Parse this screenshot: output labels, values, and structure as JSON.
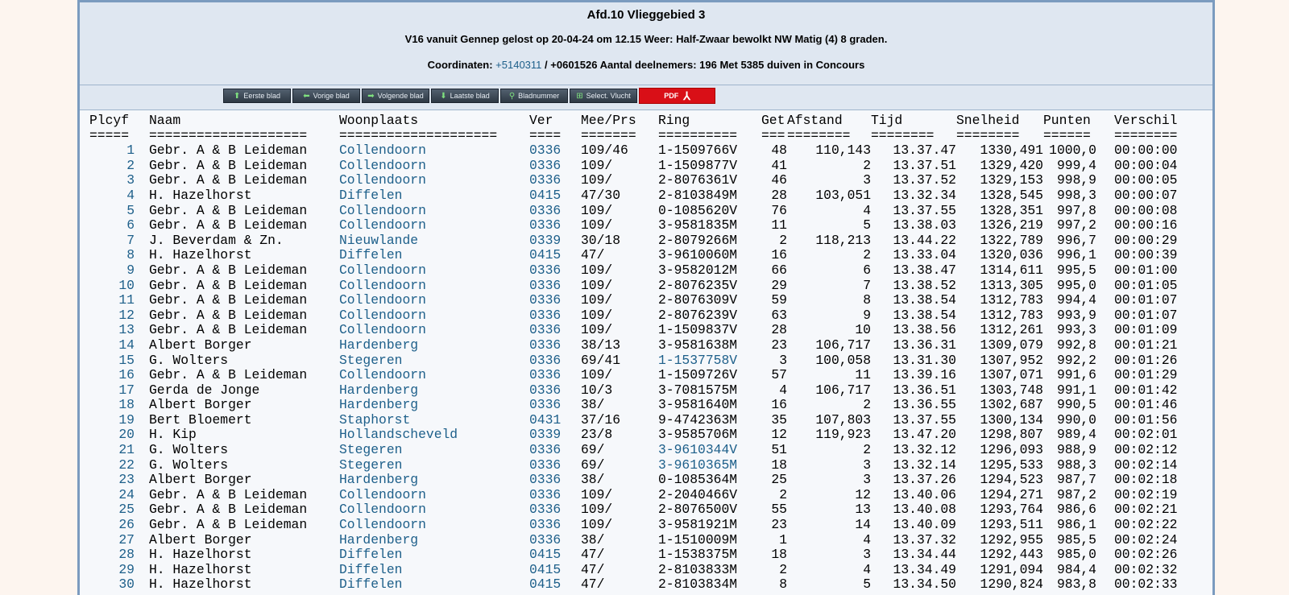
{
  "header": {
    "title": "Afd.10 Vlieggebied 3",
    "flight_info": "V16 vanuit Gennep gelost op 20-04-24 om 12.15 Weer: Half-Zwaar bewolkt NW Matig (4) 8 graden.",
    "coord_label": "Coordinaten:",
    "coord_lat": "+5140311",
    "coord_rest": "/ +0601526 Aantal deelnemers: 196 Met 5385 duiven in Concours"
  },
  "toolbar": {
    "buttons": [
      {
        "label": "Eerste blad",
        "icon": "arrow-up-icon"
      },
      {
        "label": "Vorige blad",
        "icon": "arrow-left-icon"
      },
      {
        "label": "Volgende blad",
        "icon": "arrow-right-icon"
      },
      {
        "label": "Laatste blad",
        "icon": "arrow-down-icon"
      },
      {
        "label": "Bladnummer",
        "icon": "search-icon"
      },
      {
        "label": "Select. Vlucht",
        "icon": "plus-icon"
      }
    ],
    "pdf_label": "PDF"
  },
  "columns": [
    "Plcyf",
    "Naam",
    "Woonplaats",
    "Ver",
    "Mee/Prs",
    "Ring",
    "Get",
    "Afstand",
    "Tijd",
    "Snelheid",
    "Punten",
    "Verschil"
  ],
  "underlines": [
    "=====",
    "====================",
    "====================",
    "====",
    "=======",
    "==========",
    "===",
    "========",
    "========",
    "========",
    "======",
    "========"
  ],
  "rows": [
    [
      "1",
      "Gebr. A & B Leideman",
      "Collendoorn",
      "0336",
      "109/46",
      "1-1509766V",
      "48",
      "110,143",
      "13.37.47",
      "1330,491",
      "1000,0",
      "00:00:00"
    ],
    [
      "2",
      "Gebr. A & B Leideman",
      "Collendoorn",
      "0336",
      "109/",
      "1-1509877V",
      "41",
      "2",
      "13.37.51",
      "1329,420",
      "999,4",
      "00:00:04"
    ],
    [
      "3",
      "Gebr. A & B Leideman",
      "Collendoorn",
      "0336",
      "109/",
      "2-8076361V",
      "46",
      "3",
      "13.37.52",
      "1329,153",
      "998,9",
      "00:00:05"
    ],
    [
      "4",
      "H. Hazelhorst",
      "Diffelen",
      "0415",
      "47/30",
      "2-8103849M",
      "28",
      "103,051",
      "13.32.34",
      "1328,545",
      "998,3",
      "00:00:07"
    ],
    [
      "5",
      "Gebr. A & B Leideman",
      "Collendoorn",
      "0336",
      "109/",
      "0-1085620V",
      "76",
      "4",
      "13.37.55",
      "1328,351",
      "997,8",
      "00:00:08"
    ],
    [
      "6",
      "Gebr. A & B Leideman",
      "Collendoorn",
      "0336",
      "109/",
      "3-9581835M",
      "11",
      "5",
      "13.38.03",
      "1326,219",
      "997,2",
      "00:00:16"
    ],
    [
      "7",
      "J. Beverdam & Zn.",
      "Nieuwlande",
      "0339",
      "30/18",
      "2-8079266M",
      "2",
      "118,213",
      "13.44.22",
      "1322,789",
      "996,7",
      "00:00:29"
    ],
    [
      "8",
      "H. Hazelhorst",
      "Diffelen",
      "0415",
      "47/",
      "3-9610060M",
      "16",
      "2",
      "13.33.04",
      "1320,036",
      "996,1",
      "00:00:39"
    ],
    [
      "9",
      "Gebr. A & B Leideman",
      "Collendoorn",
      "0336",
      "109/",
      "3-9582012M",
      "66",
      "6",
      "13.38.47",
      "1314,611",
      "995,5",
      "00:01:00"
    ],
    [
      "10",
      "Gebr. A & B Leideman",
      "Collendoorn",
      "0336",
      "109/",
      "2-8076235V",
      "29",
      "7",
      "13.38.52",
      "1313,305",
      "995,0",
      "00:01:05"
    ],
    [
      "11",
      "Gebr. A & B Leideman",
      "Collendoorn",
      "0336",
      "109/",
      "2-8076309V",
      "59",
      "8",
      "13.38.54",
      "1312,783",
      "994,4",
      "00:01:07"
    ],
    [
      "12",
      "Gebr. A & B Leideman",
      "Collendoorn",
      "0336",
      "109/",
      "2-8076239V",
      "63",
      "9",
      "13.38.54",
      "1312,783",
      "993,9",
      "00:01:07"
    ],
    [
      "13",
      "Gebr. A & B Leideman",
      "Collendoorn",
      "0336",
      "109/",
      "1-1509837V",
      "28",
      "10",
      "13.38.56",
      "1312,261",
      "993,3",
      "00:01:09"
    ],
    [
      "14",
      "Albert Borger",
      "Hardenberg",
      "0336",
      "38/13",
      "3-9581638M",
      "23",
      "106,717",
      "13.36.31",
      "1309,079",
      "992,8",
      "00:01:21"
    ],
    [
      "15",
      "G. Wolters",
      "Stegeren",
      "0336",
      "69/41",
      "1-1537758V",
      "3",
      "100,058",
      "13.31.30",
      "1307,952",
      "992,2",
      "00:01:26"
    ],
    [
      "16",
      "Gebr. A & B Leideman",
      "Collendoorn",
      "0336",
      "109/",
      "1-1509726V",
      "57",
      "11",
      "13.39.16",
      "1307,071",
      "991,6",
      "00:01:29"
    ],
    [
      "17",
      "Gerda de Jonge",
      "Hardenberg",
      "0336",
      "10/3",
      "3-7081575M",
      "4",
      "106,717",
      "13.36.51",
      "1303,748",
      "991,1",
      "00:01:42"
    ],
    [
      "18",
      "Albert Borger",
      "Hardenberg",
      "0336",
      "38/",
      "3-9581640M",
      "16",
      "2",
      "13.36.55",
      "1302,687",
      "990,5",
      "00:01:46"
    ],
    [
      "19",
      "Bert Bloemert",
      "Staphorst",
      "0431",
      "37/16",
      "9-4742363M",
      "35",
      "107,803",
      "13.37.55",
      "1300,134",
      "990,0",
      "00:01:56"
    ],
    [
      "20",
      "H. Kip",
      "Hollandscheveld",
      "0339",
      "23/8",
      "3-9585706M",
      "12",
      "119,923",
      "13.47.20",
      "1298,807",
      "989,4",
      "00:02:01"
    ],
    [
      "21",
      "G. Wolters",
      "Stegeren",
      "0336",
      "69/",
      "3-9610344V",
      "51",
      "2",
      "13.32.12",
      "1296,093",
      "988,9",
      "00:02:12"
    ],
    [
      "22",
      "G. Wolters",
      "Stegeren",
      "0336",
      "69/",
      "3-9610365M",
      "18",
      "3",
      "13.32.14",
      "1295,533",
      "988,3",
      "00:02:14"
    ],
    [
      "23",
      "Albert Borger",
      "Hardenberg",
      "0336",
      "38/",
      "0-1085364M",
      "25",
      "3",
      "13.37.26",
      "1294,523",
      "987,7",
      "00:02:18"
    ],
    [
      "24",
      "Gebr. A & B Leideman",
      "Collendoorn",
      "0336",
      "109/",
      "2-2040466V",
      "2",
      "12",
      "13.40.06",
      "1294,271",
      "987,2",
      "00:02:19"
    ],
    [
      "25",
      "Gebr. A & B Leideman",
      "Collendoorn",
      "0336",
      "109/",
      "2-8076500V",
      "55",
      "13",
      "13.40.08",
      "1293,764",
      "986,6",
      "00:02:21"
    ],
    [
      "26",
      "Gebr. A & B Leideman",
      "Collendoorn",
      "0336",
      "109/",
      "3-9581921M",
      "23",
      "14",
      "13.40.09",
      "1293,511",
      "986,1",
      "00:02:22"
    ],
    [
      "27",
      "Albert Borger",
      "Hardenberg",
      "0336",
      "38/",
      "1-1510009M",
      "1",
      "4",
      "13.37.32",
      "1292,955",
      "985,5",
      "00:02:24"
    ],
    [
      "28",
      "H. Hazelhorst",
      "Diffelen",
      "0415",
      "47/",
      "1-1538375M",
      "18",
      "3",
      "13.34.44",
      "1292,443",
      "985,0",
      "00:02:26"
    ],
    [
      "29",
      "H. Hazelhorst",
      "Diffelen",
      "0415",
      "47/",
      "2-8103833M",
      "2",
      "4",
      "13.34.49",
      "1291,094",
      "984,4",
      "00:02:32"
    ],
    [
      "30",
      "H. Hazelhorst",
      "Diffelen",
      "0415",
      "47/",
      "2-8103834M",
      "8",
      "5",
      "13.34.50",
      "1290,824",
      "983,8",
      "00:02:33"
    ]
  ],
  "linked_rings": [
    "1-1537758V",
    "3-9610344V",
    "3-9610365M"
  ],
  "colors": {
    "link": "#1d5f8a",
    "pdf": "#d90f17",
    "frame": "#7b9bbf"
  }
}
